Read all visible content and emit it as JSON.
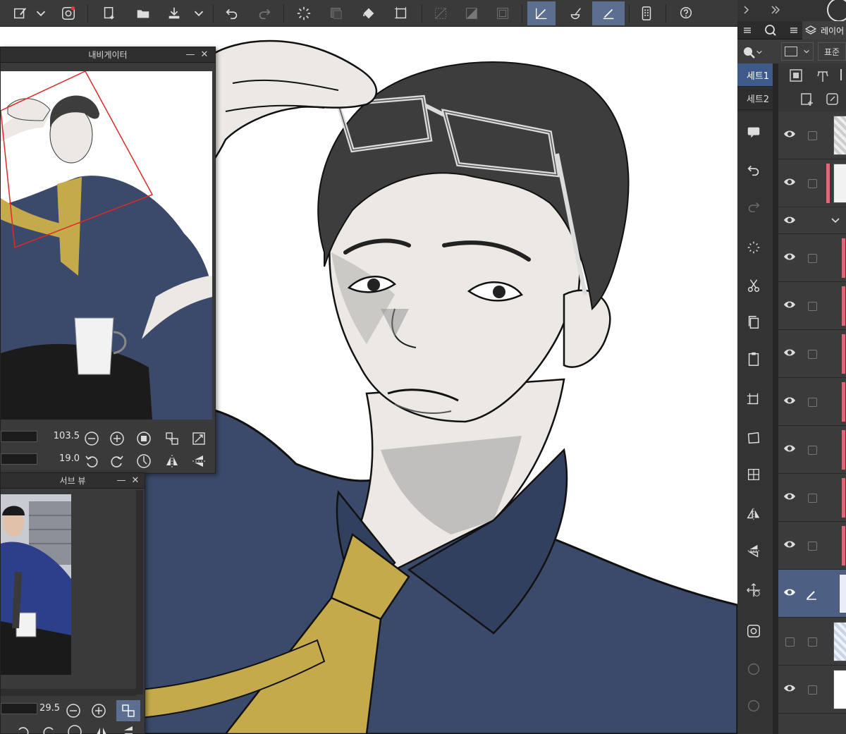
{
  "toolbar": {
    "icons": [
      "tool-settings-icon",
      "dropdown-icon",
      "clip-studio-icon",
      "new-canvas-icon",
      "open-folder-icon",
      "save-icon",
      "save-dropdown-icon",
      "undo-icon",
      "redo-icon",
      "loading-icon",
      "hide-selection-icon",
      "fill-icon",
      "selection-rect-icon",
      "deselect-icon",
      "invert-selection-icon",
      "show-grid-icon",
      "pen-tool-icon",
      "fill-tool-icon",
      "eraser-tool-icon",
      "companion-icon",
      "help-icon"
    ]
  },
  "right_panel": {
    "tab_label": "레이어",
    "blend_mode": "표준",
    "sets": [
      {
        "label": "세트1"
      },
      {
        "label": "세트2"
      }
    ]
  },
  "navigator": {
    "title": "내비게이터",
    "zoom_value": "103.5",
    "rotation_value": "19.0"
  },
  "subview": {
    "title": "서브 뷰",
    "zoom_value": "29.5"
  },
  "colors": {
    "toolbar_bg": "#3a3a3a",
    "accent": "#5d6f91",
    "shirt": "#3b4a6a",
    "tie": "#c5aa4c",
    "hair": "#3d3d3d",
    "skin": "#ece8e4",
    "layer_color_label": "#d96b76"
  }
}
